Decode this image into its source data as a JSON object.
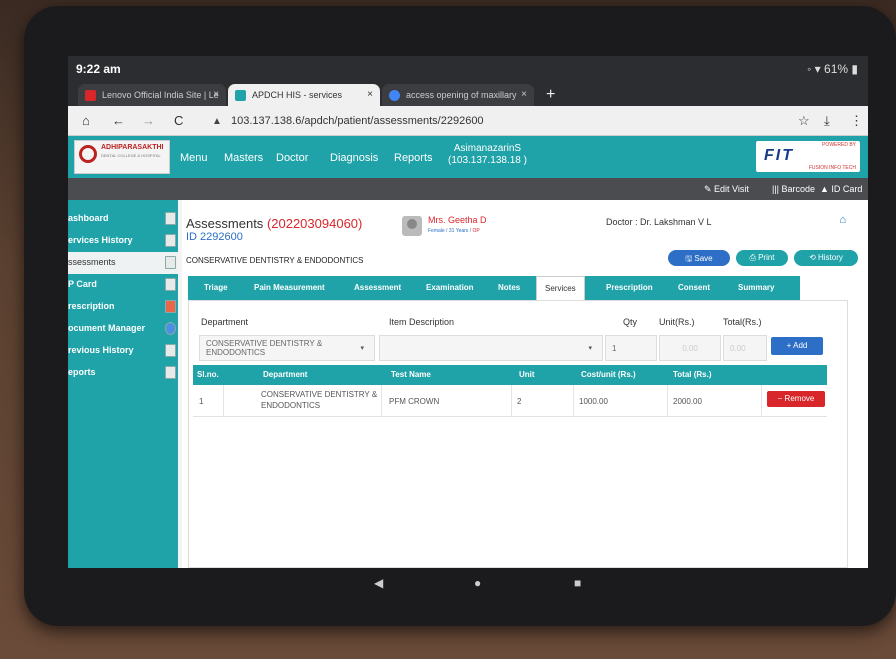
{
  "status": {
    "time": "9:22 am",
    "indicators": "◦ ▾ 61% ▮"
  },
  "browser": {
    "tabs": [
      {
        "title": "Lenovo Official India Site | Le",
        "close": "×"
      },
      {
        "title": "APDCH HIS - services",
        "close": "×"
      },
      {
        "title": "access opening of maxillary",
        "close": "×"
      }
    ],
    "new_tab": "+",
    "url": "103.137.138.6/apdch/patient/assessments/2292600",
    "warning_icon": "▲"
  },
  "app": {
    "logo_text": "ADHIPARASAKTHI",
    "logo_sub": "DENTAL COLLEGE & HOSPITAL",
    "menu": [
      "Menu",
      "Masters",
      "Doctor",
      "Diagnosis",
      "Reports"
    ],
    "user_name": "AsimanazarinS",
    "user_ip": "(103.137.138.18 )",
    "powered_by": "POWERED BY",
    "fit_logo": "FIT",
    "fit_sub": "FUSION INFO TECH",
    "actions": [
      "✎ Edit Visit",
      "||| Barcode",
      "▲ ID Card"
    ]
  },
  "sidebar": {
    "items": [
      {
        "label": "ashboard"
      },
      {
        "label": "ervices History"
      },
      {
        "label": "ssessments"
      },
      {
        "label": "P Card"
      },
      {
        "label": "rescription"
      },
      {
        "label": "ocument Manager"
      },
      {
        "label": "revious History"
      },
      {
        "label": "eports"
      }
    ]
  },
  "header": {
    "title": "Assessments",
    "title_code": "(202203094060)",
    "id": "ID 2292600",
    "patient_name": "Mrs. Geetha D",
    "patient_meta": "Female / 31 Years /",
    "patient_type": "OP",
    "doctor": "Doctor : Dr. Lakshman V L",
    "section": "CONSERVATIVE DENTISTRY & ENDODONTICS",
    "buttons": {
      "save": "🖫 Save",
      "print": "⎙ Print",
      "history": "⟲ History"
    }
  },
  "tabs": [
    "Triage",
    "Pain Measurement",
    "Assessment",
    "Examination",
    "Notes",
    "Services",
    "Prescription",
    "Consent",
    "Summary"
  ],
  "form": {
    "labels": {
      "department": "Department",
      "item": "Item Description",
      "qty": "Qty",
      "unit": "Unit(Rs.)",
      "total": "Total(Rs.)"
    },
    "department_value": "CONSERVATIVE DENTISTRY & ENDODONTICS",
    "item_value": "",
    "qty_value": "1",
    "unit_value": "0.00",
    "total_value": "0.00",
    "add_label": "+ Add"
  },
  "table": {
    "headers": [
      "Sl.no.",
      "Department",
      "Test Name",
      "Unit",
      "Cost/unit (Rs.)",
      "Total (Rs.)"
    ],
    "rows": [
      {
        "slno": "1",
        "department": "CONSERVATIVE DENTISTRY & ENDODONTICS",
        "test": "PFM CROWN",
        "unit": "2",
        "cost": "1000.00",
        "total": "2000.00",
        "remove": "− Remove"
      }
    ]
  },
  "android_nav": {
    "back": "◀",
    "home": "●",
    "recents": "■"
  }
}
